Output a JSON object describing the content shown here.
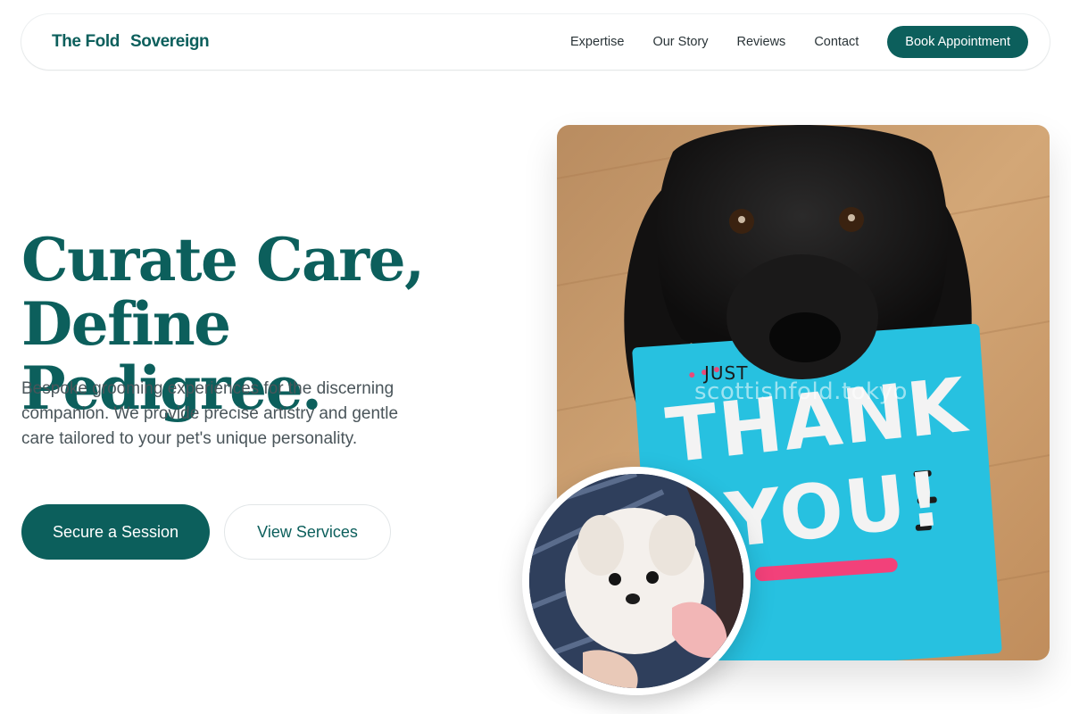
{
  "nav": {
    "brand_part1": "The Fold",
    "brand_part2": "Sovereign",
    "links": [
      "Expertise",
      "Our Story",
      "Reviews",
      "Contact"
    ],
    "cta": "Book Appointment"
  },
  "hero": {
    "title_line1": "Curate Care,",
    "title_line2": "Define Pedigree.",
    "subtitle": "Bespoke grooming experiences for the discerning companion. We provide precise artistry and gentle care tailored to your pet's unique personality.",
    "primary_button": "Secure a Session",
    "secondary_button": "View Services"
  },
  "photo": {
    "watermark": "scottishfold.tokyo",
    "card_text_top": "JUST",
    "card_text_main": "THANK",
    "card_text_bottom": "YOU!"
  },
  "colors": {
    "brand": "#0c5f5c",
    "text_muted": "#4a555a",
    "card_blue": "#27c1e0",
    "wood": "#c69a6a"
  }
}
